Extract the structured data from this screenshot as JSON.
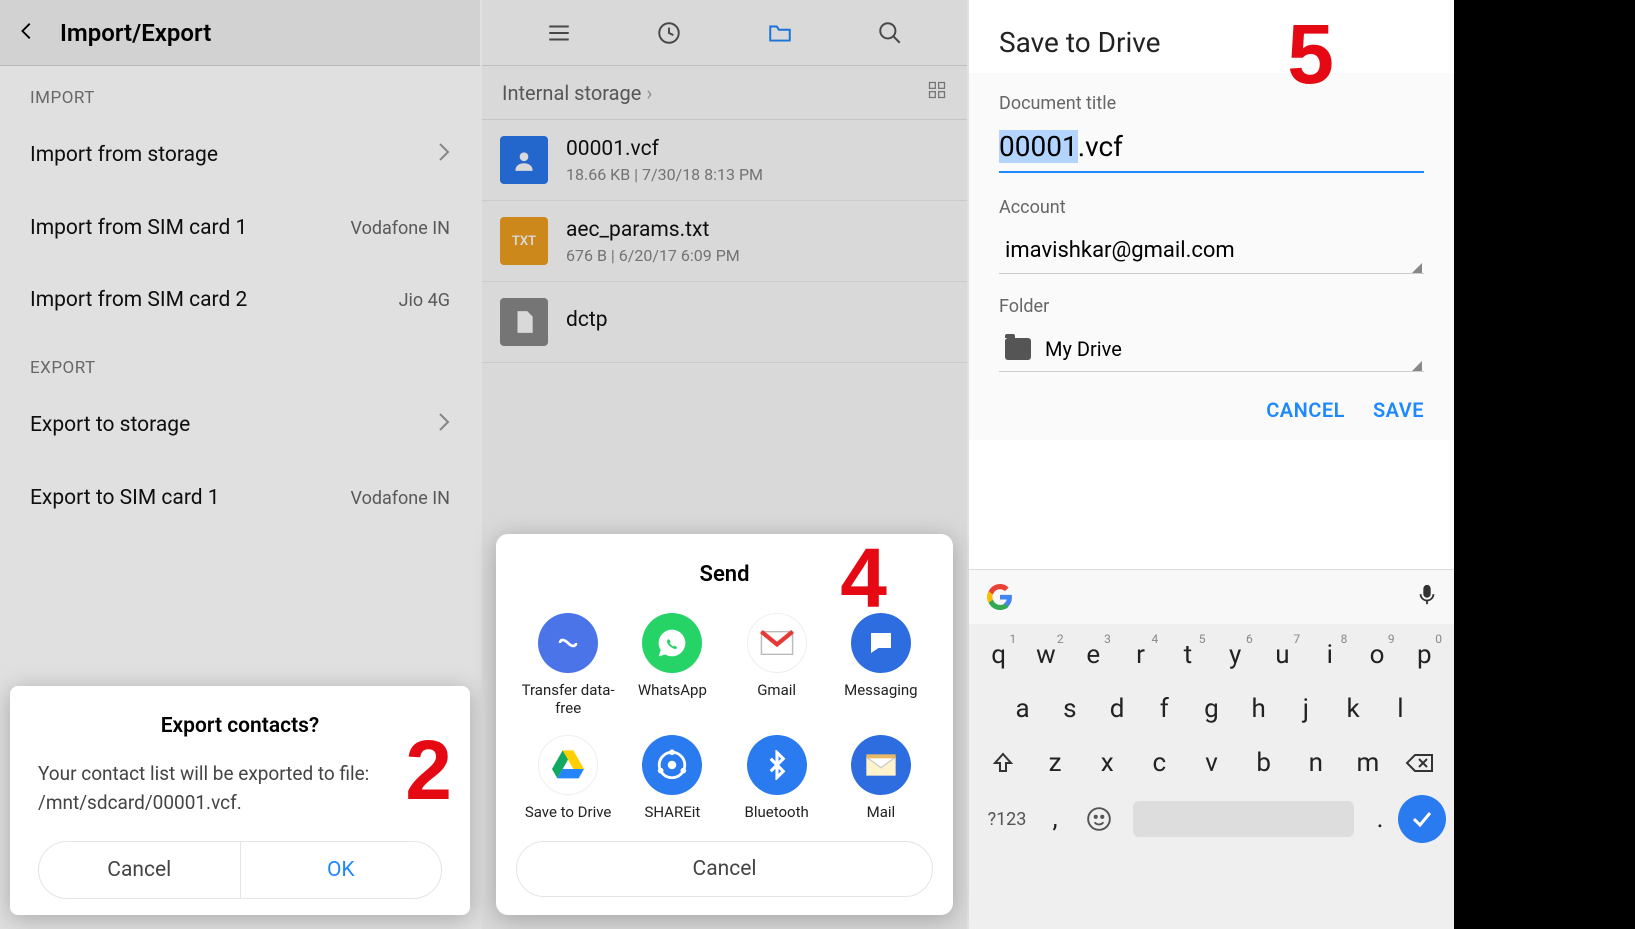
{
  "panel1": {
    "title": "Import/Export",
    "import_header": "IMPORT",
    "export_header": "EXPORT",
    "rows": {
      "import_storage": "Import from storage",
      "import_sim1": "Import from SIM card 1",
      "import_sim1_r": "Vodafone IN",
      "import_sim2": "Import from SIM card 2",
      "import_sim2_r": "Jio 4G",
      "export_storage": "Export to storage",
      "export_sim1": "Export to SIM card 1",
      "export_sim1_r": "Vodafone IN"
    },
    "dialog": {
      "title": "Export contacts?",
      "body": "Your contact list will be exported to file: /mnt/sdcard/00001.vcf.",
      "cancel": "Cancel",
      "ok": "OK"
    },
    "step": "2"
  },
  "panel2": {
    "breadcrumb": "Internal storage",
    "files": {
      "f1_name": "00001.vcf",
      "f1_meta": "18.66 KB  |  7/30/18 8:13 PM",
      "f2_name": "aec_params.txt",
      "f2_meta": "676 B  |  6/20/17 6:09 PM",
      "f3_name": "dctp"
    },
    "sheet": {
      "title": "Send",
      "apps": {
        "a1": "Transfer data-free",
        "a2": "WhatsApp",
        "a3": "Gmail",
        "a4": "Messaging",
        "a5": "Save to Drive",
        "a6": "SHAREit",
        "a7": "Bluetooth",
        "a8": "Mail"
      },
      "cancel": "Cancel"
    },
    "step": "4"
  },
  "panel3": {
    "title": "Save to Drive",
    "doc_label": "Document title",
    "doc_sel": "00001",
    "doc_rest": ".vcf",
    "account_label": "Account",
    "account_val": "imavishkar@gmail.com",
    "folder_label": "Folder",
    "folder_val": "My Drive",
    "cancel": "CANCEL",
    "save": "SAVE",
    "step": "5",
    "keyboard": {
      "row1": [
        "q",
        "w",
        "e",
        "r",
        "t",
        "y",
        "u",
        "i",
        "o",
        "p"
      ],
      "sup1": [
        "1",
        "2",
        "3",
        "4",
        "5",
        "6",
        "7",
        "8",
        "9",
        "0"
      ],
      "row2": [
        "a",
        "s",
        "d",
        "f",
        "g",
        "h",
        "j",
        "k",
        "l"
      ],
      "row3": [
        "z",
        "x",
        "c",
        "v",
        "b",
        "n",
        "m"
      ],
      "sym": "?123",
      "comma": ",",
      "period": "."
    }
  }
}
